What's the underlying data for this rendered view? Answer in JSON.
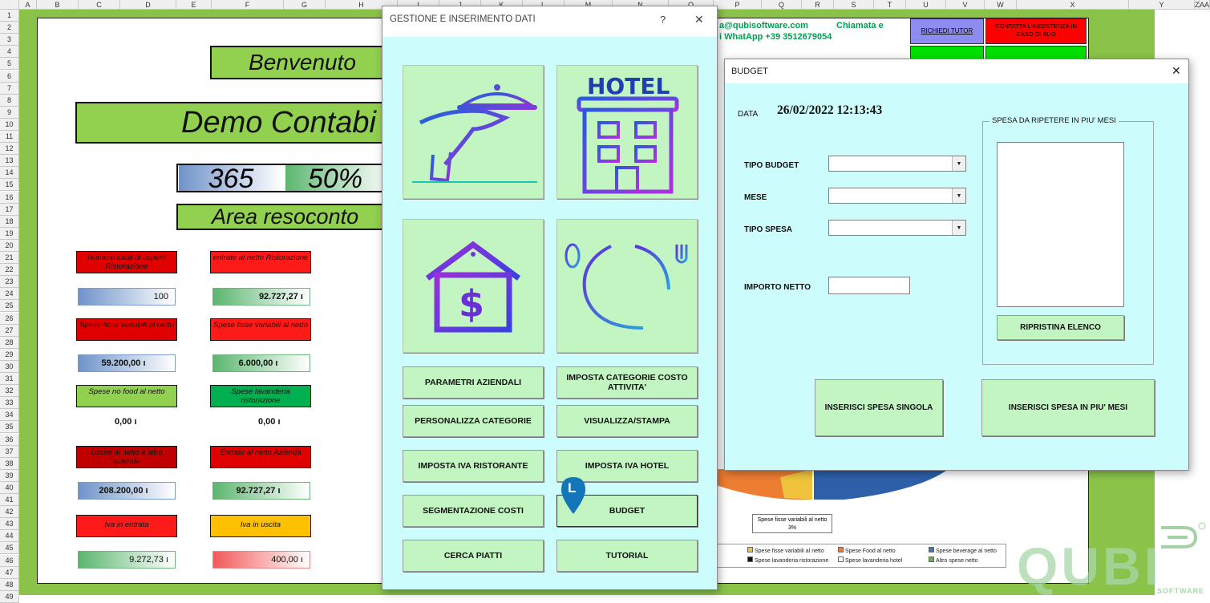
{
  "sheet": {
    "columns": [
      "A",
      "B",
      "C",
      "D",
      "E",
      "F",
      "G",
      "H",
      "I",
      "J",
      "K",
      "L",
      "M",
      "N",
      "O",
      "P",
      "Q",
      "R",
      "S",
      "T",
      "U",
      "V",
      "W",
      "X",
      "Y",
      "Z",
      "AA"
    ],
    "rows": [
      "1",
      "2",
      "3",
      "4",
      "5",
      "6",
      "7",
      "8",
      "9",
      "10",
      "11",
      "12",
      "13",
      "14",
      "15",
      "16",
      "17",
      "18",
      "19",
      "20",
      "21",
      "22",
      "23",
      "24",
      "25",
      "26",
      "27",
      "28",
      "29",
      "30",
      "31",
      "32",
      "33",
      "34",
      "35",
      "36",
      "37",
      "38",
      "39",
      "40",
      "41",
      "42",
      "43",
      "44",
      "45",
      "46",
      "47",
      "48",
      "49"
    ],
    "welcome": "Benvenuto",
    "demo_title": "Demo Contabi",
    "days": "365",
    "percent": "50%",
    "area_title": "Area resoconto",
    "labels": {
      "coperti": "Numero totali di coperti Ristorazione",
      "entrate_ristorazione": "entrate al netto Ristorazione",
      "spese_fisse_1": "Spese fisse variabili al netto",
      "spese_fisse_2": "Spese fisse variabili al netto",
      "spese_no_food": "Spese no food al netto",
      "spese_lavanderia": "Spese lavanderia ristorazione",
      "uscite_azienda": "Uscite al netto e altro azienda",
      "entrate_azienda": "Entrate al netto Azienda",
      "iva_entrata": "Iva in entrata",
      "iva_uscita": "Iva in uscita"
    },
    "values": {
      "coperti": "100",
      "entrate_ristorazione": "92.727,27 ı",
      "spese_fisse_1": "59.200,00 ı",
      "spese_fisse_2": "6.000,00 ı",
      "spese_no_food": "0,00 ı",
      "spese_lavanderia": "0,00 ı",
      "uscite_azienda": "208.200,00 ı",
      "entrate_azienda": "92.727,27 ı",
      "iva_entrata": "9.272,73 ı",
      "iva_uscita": "400,00 ı"
    },
    "contact": {
      "email": "a@qubisoftware.com",
      "call": "Chiamata e",
      "whatsapp": "i WhatApp  +39 3512679054",
      "tutor_button": "RICHIEDI TUTOR",
      "support_button": "CONTATTA L'ASSISTENZA IN CASO DI BUG"
    },
    "chart": {
      "callout": "Spese fisse variabili al netto",
      "callout_pct": "3%",
      "legend": [
        "Spese fisse variabili al netto",
        "Spese Food al netto",
        "Spese beverage al netto",
        "Spese lavanderia ristorazione",
        "Spese lavanderia hotel",
        "Altro spese netto"
      ],
      "legend_colors": [
        "#f0c33c",
        "#ed7d31",
        "#4472c4",
        "#111111",
        "#ffffff",
        "#70ad47"
      ]
    },
    "logo": {
      "name": "QUBI",
      "sub": "SOFTWARE"
    }
  },
  "gestione": {
    "title": "GESTIONE E INSERIMENTO DATI",
    "help": "?",
    "close": "✕",
    "tiles": [
      "waiter-serving-icon",
      "hotel-building-icon",
      "house-dollar-icon",
      "plate-cutlery-icon"
    ],
    "hotel_word": "HOTEL",
    "buttons": {
      "parametri": "PARAMETRI AZIENDALI",
      "categorie_costo": "IMPOSTA CATEGORIE COSTO ATTIVITA'",
      "personalizza": "PERSONALIZZA CATEGORIE",
      "visualizza": "VISUALIZZA/STAMPA",
      "iva_ristorante": "IMPOSTA IVA RISTORANTE",
      "iva_hotel": "IMPOSTA IVA HOTEL",
      "segmentazione": "SEGMENTAZIONE COSTI",
      "budget": "BUDGET",
      "cerca_piatti": "CERCA PIATTI",
      "tutorial": "TUTORIAL"
    },
    "cursor_letter": "L"
  },
  "budget": {
    "title": "BUDGET",
    "close": "✕",
    "data_label": "DATA",
    "datetime": "26/02/2022 12:13:43",
    "tipo_budget_label": "TIPO BUDGET",
    "mese_label": "MESE",
    "tipo_spesa_label": "TIPO SPESA",
    "importo_label": "IMPORTO NETTO",
    "importo_value": "",
    "tipo_budget_value": "",
    "mese_value": "",
    "tipo_spesa_value": "",
    "group_title": "SPESA DA RIPETERE IN PIU' MESI",
    "ripristina": "RIPRISTINA ELENCO",
    "inserisci_singola": "INSERISCI SPESA SINGOLA",
    "inserisci_mesi": "INSERISCI SPESA IN PIU' MESI"
  }
}
